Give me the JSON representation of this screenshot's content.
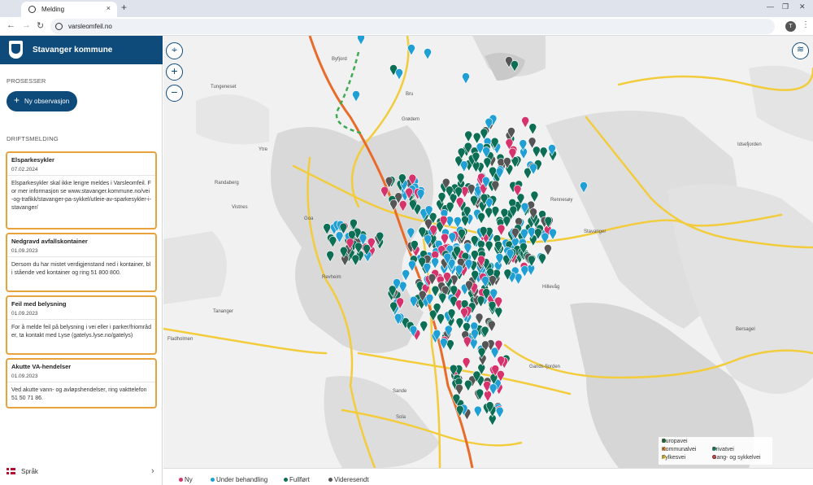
{
  "browser": {
    "tab_title": "Melding",
    "new_tab": "+",
    "url": "varsleomfeil.no",
    "profile_initial": "T"
  },
  "sidebar": {
    "brand": "Stavanger kommune",
    "processes_label": "PROSESSER",
    "new_observation": "Ny observasjon",
    "ops_label": "DRIFTSMELDING",
    "cards": [
      {
        "title": "Elsparkesykler",
        "date": "07.02.2024",
        "body": "Elsparkesykler skal ikke lengre meldes i Varsleomfeil. For mer informasjon se www.stavanger.kommune.no/vei-og-trafikk/stavanger-pa-sykkel/utleie-av-sparkesykler-i-stavanger/"
      },
      {
        "title": "Nedgravd avfallskontainer",
        "date": "01.09.2023",
        "body": "Dersom du har mistet verdigjenstand ned i kontainer, bli stående ved kontainer og ring 51 800 800."
      },
      {
        "title": "Feil med belysning",
        "date": "01.09.2023",
        "body": "For å melde feil på belysning i vei eller i parker/friområder, ta kontakt med Lyse (gatelys.lyse.no/gatelys)"
      },
      {
        "title": "Akutte VA-hendelser",
        "date": "01.09.2023",
        "body": "Ved akutte vann- og avløpshendelser, ring vakttelefon 51 50 71 86."
      }
    ],
    "language": "Språk"
  },
  "map": {
    "place_labels": [
      "Byfjord",
      "Tungeneset",
      "Bru",
      "Grødem",
      "Idsefjorden",
      "Ytre",
      "Randaberg",
      "Vistnes",
      "Goa",
      "Rennesøy",
      "Stavanger",
      "Revheim",
      "Tananger",
      "Hillevåg",
      "Fladholmen",
      "Bersagel",
      "Sola",
      "Sande",
      "Gands-fjorden"
    ],
    "road_legend": [
      {
        "label": "Europavei",
        "color": "#1a7a3a"
      },
      {
        "label": "Kommunalvei",
        "color": "#ef8f3a"
      },
      {
        "label": "Privatvei",
        "color": "#1a8a6a"
      },
      {
        "label": "Fylkesvei",
        "color": "#f2d33b"
      },
      {
        "label": "Gang- og sykkelvei",
        "color": "#d64a4a"
      }
    ]
  },
  "status_legend": [
    {
      "label": "Ny",
      "color": "#d6336c"
    },
    {
      "label": "Under behandling",
      "color": "#1f9fd4"
    },
    {
      "label": "Fullført",
      "color": "#0b6e55"
    },
    {
      "label": "Videresendt",
      "color": "#555555"
    }
  ],
  "colors": {
    "brand": "#0e4a7a",
    "card_border": "#e8a33d"
  }
}
